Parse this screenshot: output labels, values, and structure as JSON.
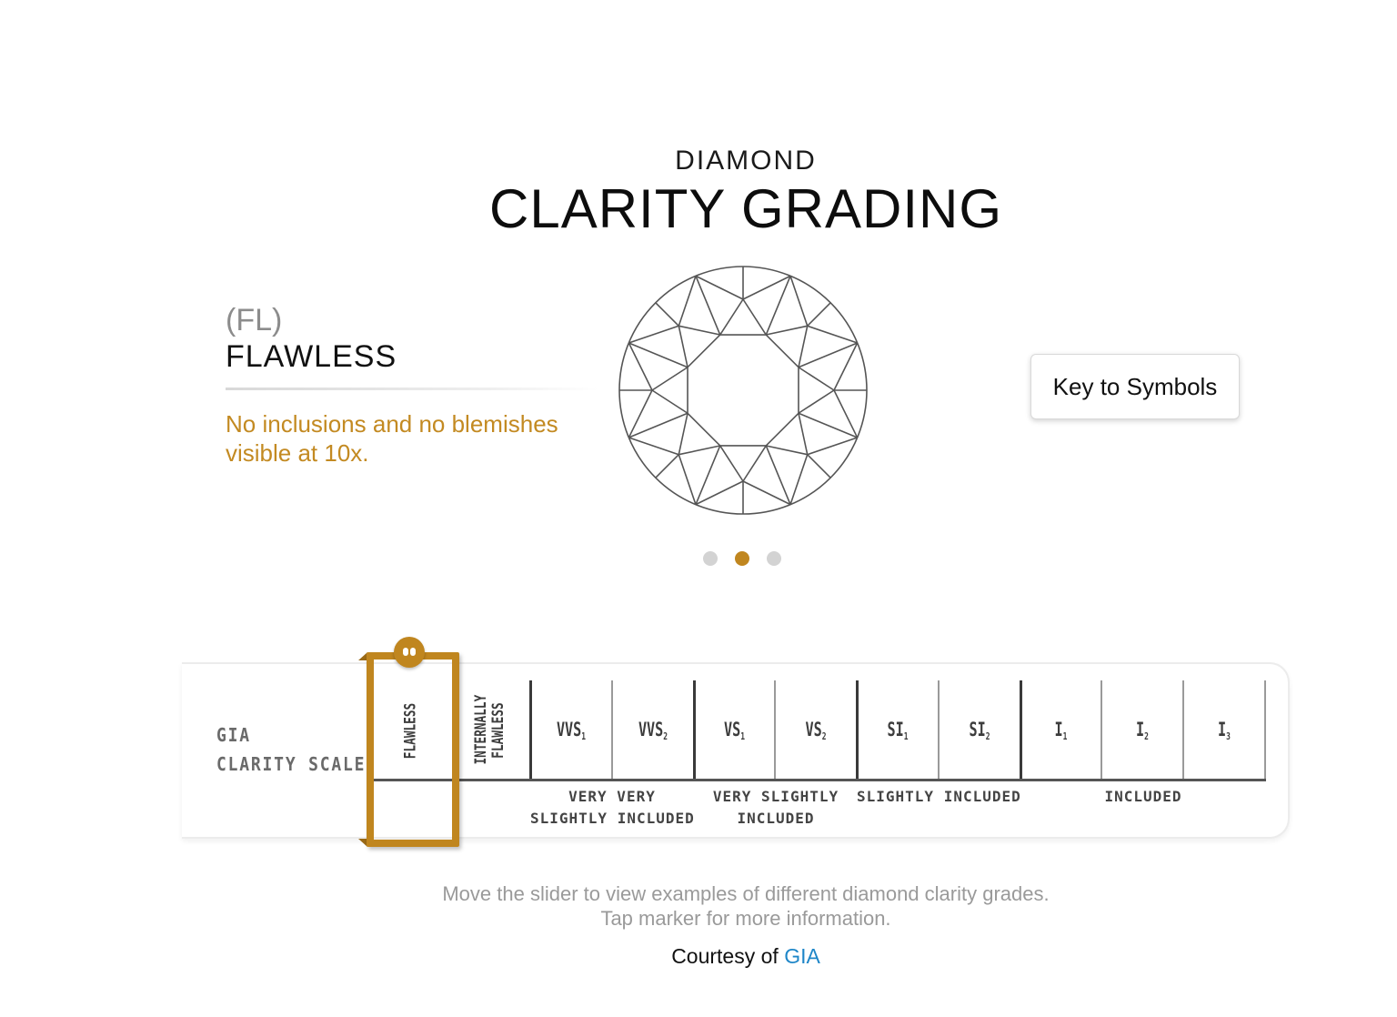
{
  "header": {
    "pre_title": "DIAMOND",
    "title": "CLARITY GRADING"
  },
  "current_grade": {
    "code": "(FL)",
    "name": "FLAWLESS",
    "description": "No inclusions and no blemishes visible at 10x."
  },
  "key_button": {
    "label": "Key to Symbols"
  },
  "carousel": {
    "count": 3,
    "active_index": 1
  },
  "scale": {
    "label_line1": "GIA",
    "label_line2": "CLARITY SCALE",
    "grades": [
      {
        "main": "FLAWLESS",
        "sub": "",
        "rotated": true
      },
      {
        "main": "INTERNALLY FLAWLESS",
        "sub": "",
        "rotated": true
      },
      {
        "main": "VVS",
        "sub": "1",
        "rotated": false
      },
      {
        "main": "VVS",
        "sub": "2",
        "rotated": false
      },
      {
        "main": "VS",
        "sub": "1",
        "rotated": false
      },
      {
        "main": "VS",
        "sub": "2",
        "rotated": false
      },
      {
        "main": "SI",
        "sub": "1",
        "rotated": false
      },
      {
        "main": "SI",
        "sub": "2",
        "rotated": false
      },
      {
        "main": "I",
        "sub": "1",
        "rotated": false
      },
      {
        "main": "I",
        "sub": "2",
        "rotated": false
      },
      {
        "main": "I",
        "sub": "3",
        "rotated": false
      }
    ],
    "groups": [
      {
        "line1": "VERY VERY",
        "line2": "SLIGHTLY INCLUDED"
      },
      {
        "line1": "VERY SLIGHTLY",
        "line2": "INCLUDED"
      },
      {
        "line1": "SLIGHTLY INCLUDED",
        "line2": ""
      },
      {
        "line1": "INCLUDED",
        "line2": ""
      }
    ],
    "selected_index": 0
  },
  "footer": {
    "help_line1": "Move the slider to view examples of different diamond clarity grades.",
    "help_line2": "Tap marker for more information.",
    "courtesy_prefix": "Courtesy of",
    "courtesy_link": "GIA"
  },
  "colors": {
    "accent_gold": "#c0861f",
    "description_gold": "#c38a22",
    "link_blue": "#1e86c8"
  },
  "icons": {
    "diamond": "round-brilliant-diamond-top-view-icon",
    "marker_handle": "slider-handle-icon"
  }
}
